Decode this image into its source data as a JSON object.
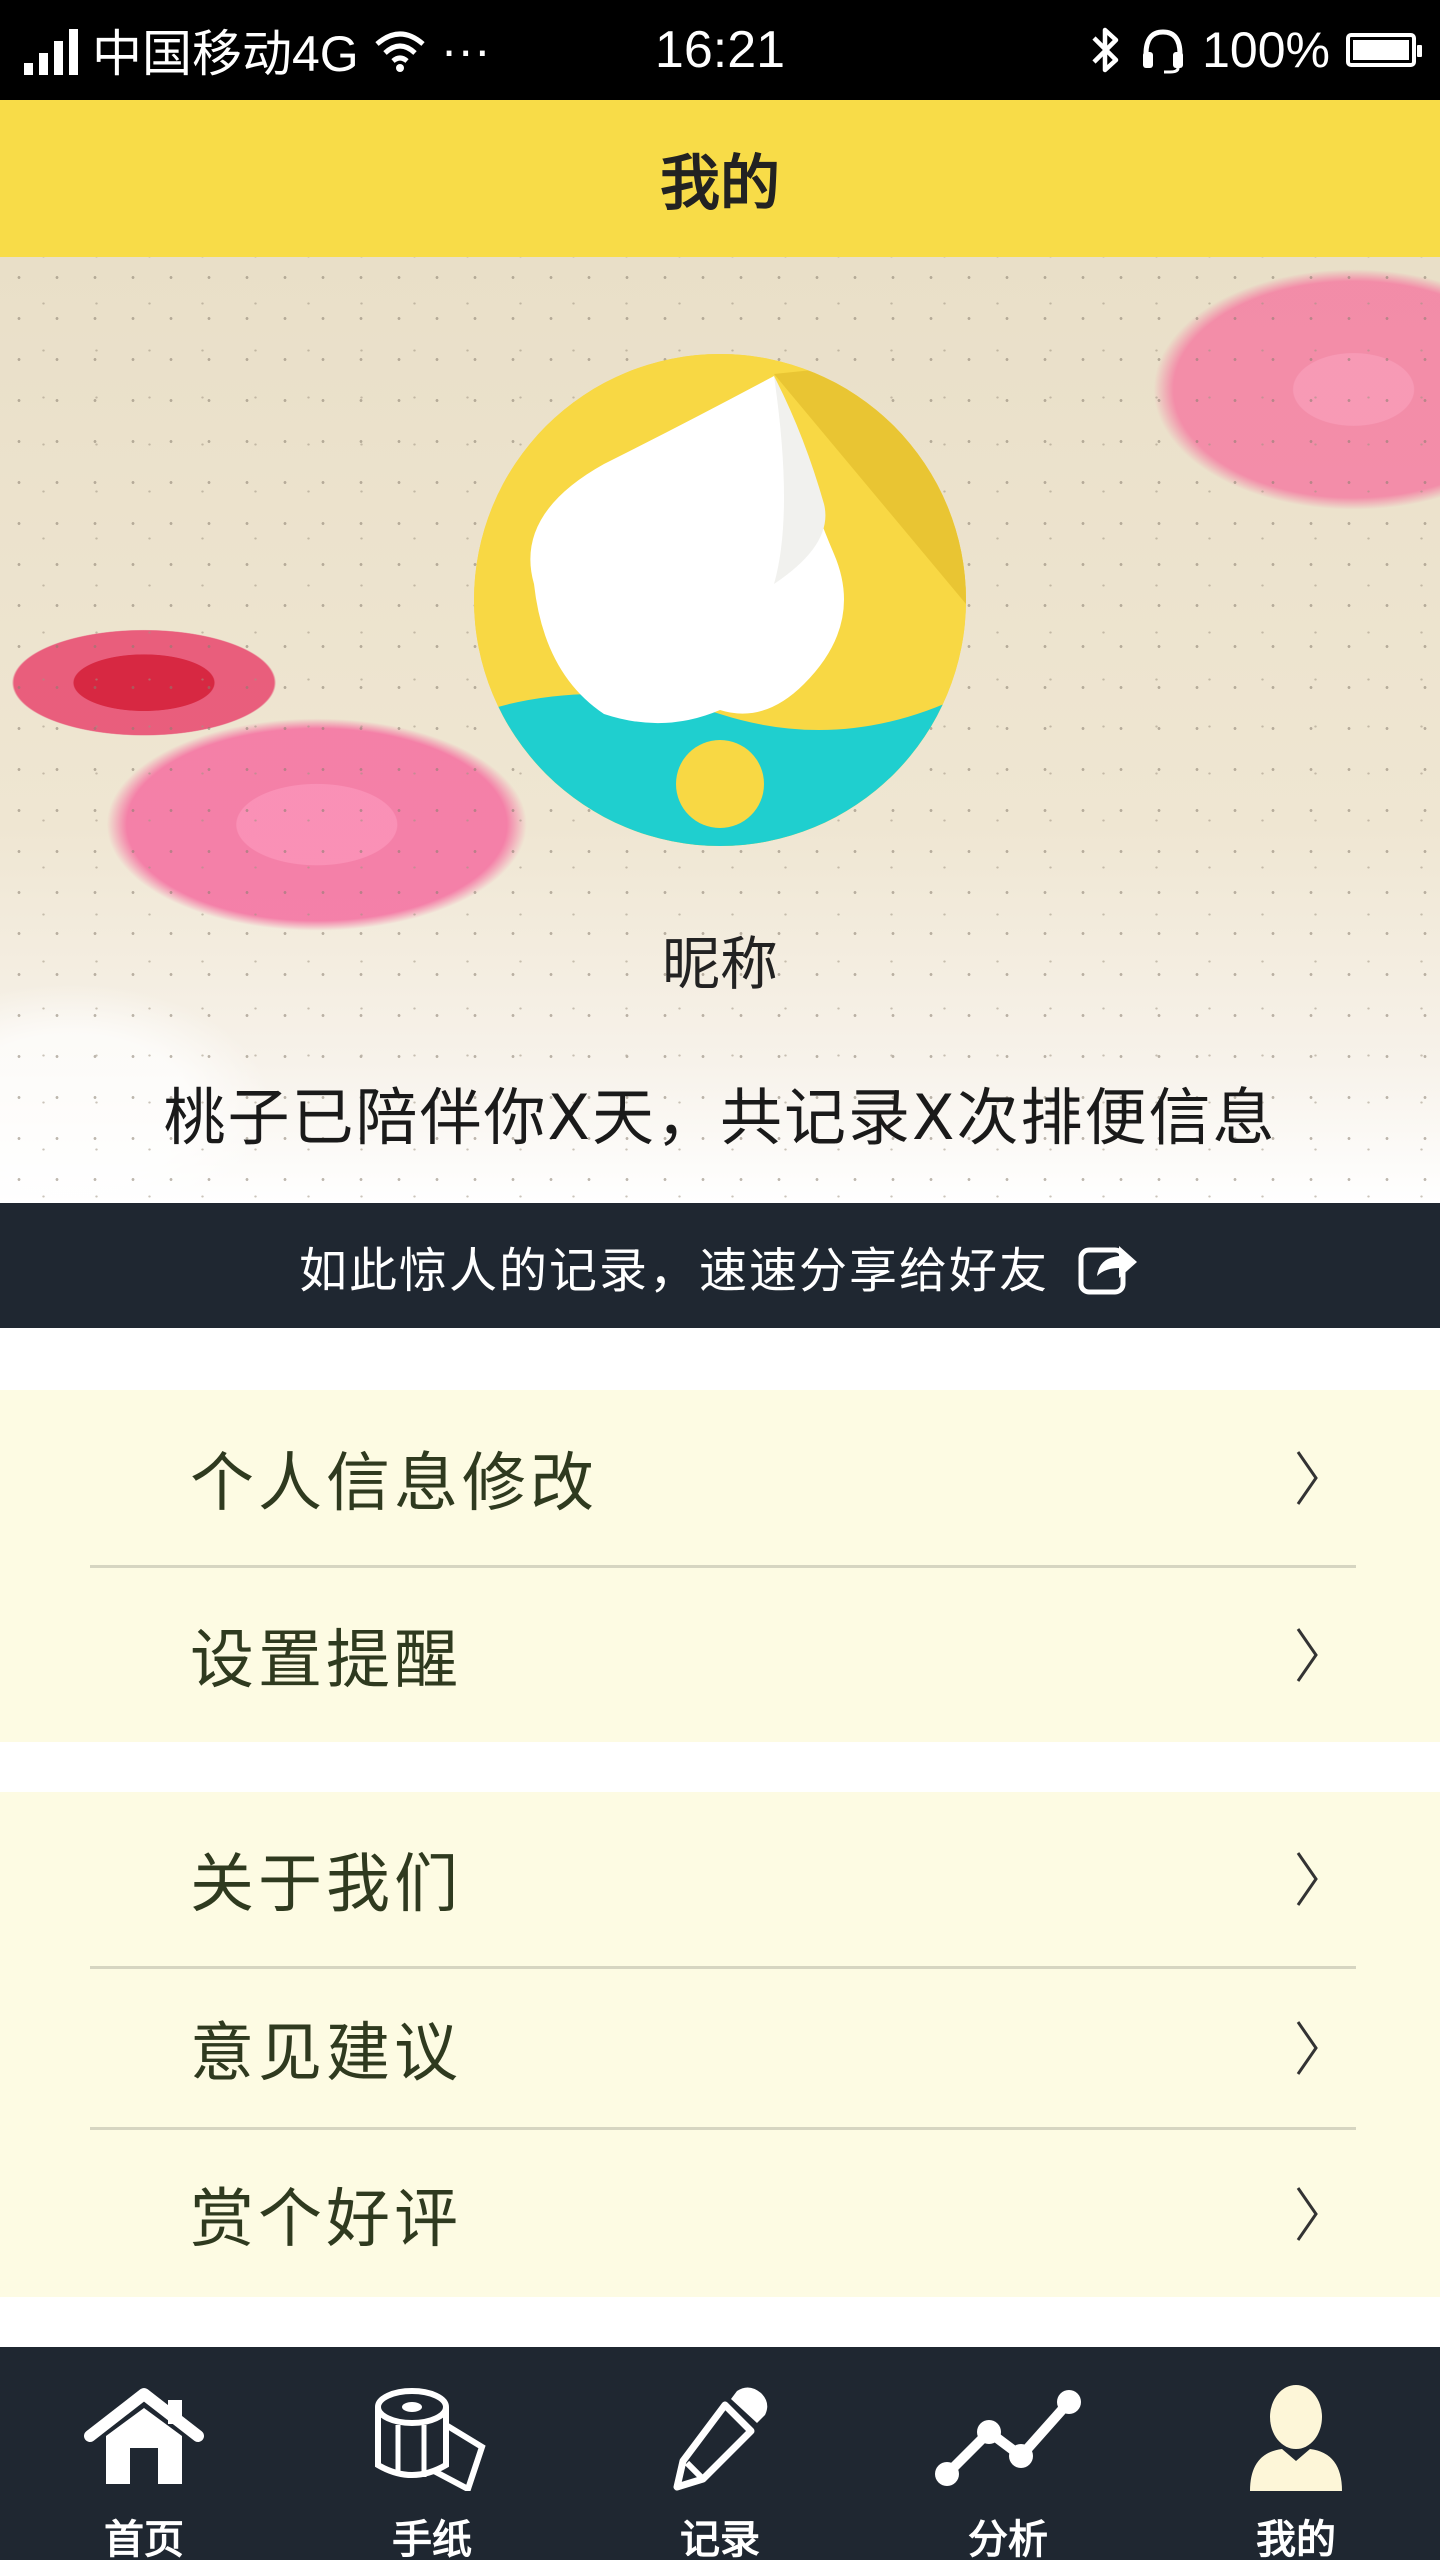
{
  "status_bar": {
    "carrier": "中国移动4G",
    "more": "···",
    "time": "16:21",
    "battery": "100%"
  },
  "header": {
    "title": "我的"
  },
  "profile": {
    "nickname": "昵称",
    "companion_text": "桃子已陪伴你X天，共记录X次排便信息"
  },
  "share": {
    "text": "如此惊人的记录，速速分享给好友"
  },
  "menu": {
    "group1": [
      {
        "label": "个人信息修改"
      },
      {
        "label": "设置提醒"
      }
    ],
    "group2": [
      {
        "label": "关于我们"
      },
      {
        "label": "意见建议"
      },
      {
        "label": "赏个好评"
      }
    ]
  },
  "tabs": [
    {
      "label": "首页",
      "icon": "home-icon"
    },
    {
      "label": "手纸",
      "icon": "toilet-paper-icon"
    },
    {
      "label": "记录",
      "icon": "pencil-icon"
    },
    {
      "label": "分析",
      "icon": "line-chart-icon"
    },
    {
      "label": "我的",
      "icon": "user-icon"
    }
  ],
  "colors": {
    "accent_yellow": "#f8dc48",
    "dark_bar": "#1f2731",
    "menu_bg": "#fdfbe3",
    "teal": "#1fcfcf"
  }
}
